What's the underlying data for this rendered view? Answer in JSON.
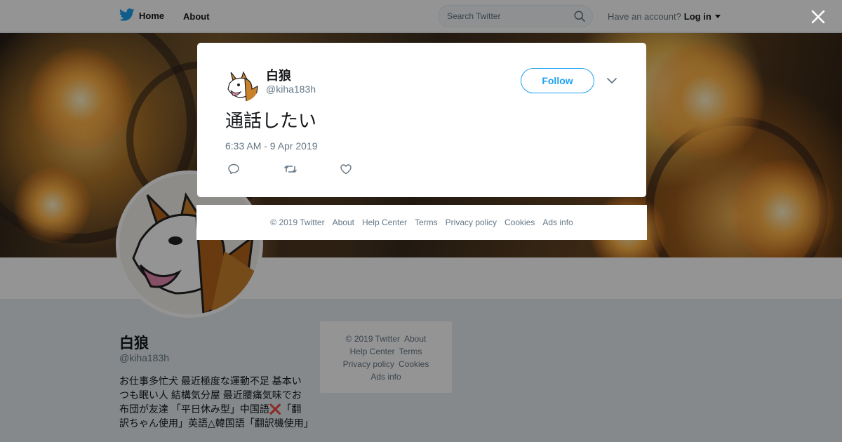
{
  "nav": {
    "home_label": "Home",
    "about_label": "About",
    "search_placeholder": "Search Twitter",
    "account_prompt": "Have an account?",
    "login_label": "Log in"
  },
  "profile": {
    "name": "白狼",
    "handle": "@kiha183h",
    "bio": "お仕事多忙犬 最近極度な運動不足 基本いつも眠い人 結構気分屋 最近腰痛気味でお布団が友達 「平日休み型」中国語❌「翻訳ちゃん使用」英語△韓国語「翻訳機使用」"
  },
  "side_footer": {
    "copyright": "© 2019 Twitter",
    "about": "About",
    "help_center": "Help Center",
    "terms": "Terms",
    "privacy": "Privacy policy",
    "cookies": "Cookies",
    "ads_info": "Ads info"
  },
  "tweet": {
    "author_name": "白狼",
    "author_handle": "@kiha183h",
    "follow_label": "Follow",
    "text": "通話したい",
    "timestamp": "6:33 AM - 9 Apr 2019"
  },
  "modal_footer": {
    "copyright": "© 2019 Twitter",
    "about": "About",
    "help_center": "Help Center",
    "terms": "Terms",
    "privacy": "Privacy policy",
    "cookies": "Cookies",
    "ads_info": "Ads info"
  },
  "colors": {
    "brand": "#1da1f2",
    "text": "#14171a",
    "muted": "#657786"
  },
  "icons": [
    "twitter-bird-icon",
    "home-icon",
    "search-icon",
    "close-icon",
    "chevron-down-icon",
    "reply-icon",
    "retweet-icon",
    "like-icon"
  ]
}
